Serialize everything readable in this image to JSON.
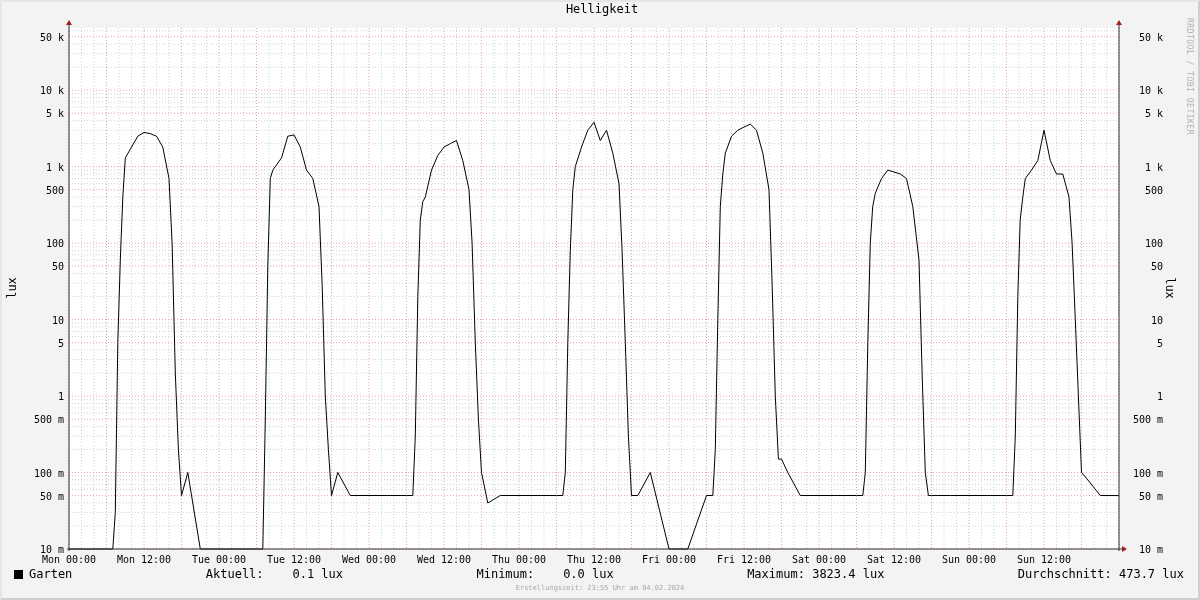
{
  "credit": "RRDTOOL / TOBI OETIKER",
  "chart": {
    "title": "Helligkeit",
    "left_axis_label": "lux",
    "right_axis_label": "lux",
    "left_tick_labels": [
      "50 k",
      "10 k",
      "5 k",
      "1 k",
      "500",
      "100",
      "50",
      "10",
      "5",
      "1",
      "500 m",
      "100 m",
      "50 m",
      "10 m"
    ],
    "right_tick_labels": [
      "50 k",
      "10 k",
      "5 k",
      "1 k",
      "500",
      "100",
      "50",
      "10",
      "5",
      "1",
      "500 m",
      "100 m",
      "50 m",
      "10 m"
    ],
    "x_tick_labels": [
      "Mon 00:00",
      "Mon 12:00",
      "Tue 00:00",
      "Tue 12:00",
      "Wed 00:00",
      "Wed 12:00",
      "Thu 00:00",
      "Thu 12:00",
      "Fri 00:00",
      "Fri 12:00",
      "Sat 00:00",
      "Sat 12:00",
      "Sun 00:00",
      "Sun 12:00"
    ]
  },
  "legend": {
    "series_label": "Garten",
    "stats": [
      "Aktuell:    0.1 lux",
      "Minimum:    0.0 lux",
      "Maximum: 3823.4 lux",
      "Durchschnitt: 473.7 lux"
    ]
  },
  "footer": "Erstellungszeit: 23:55 Uhr am 04.02.2024"
}
